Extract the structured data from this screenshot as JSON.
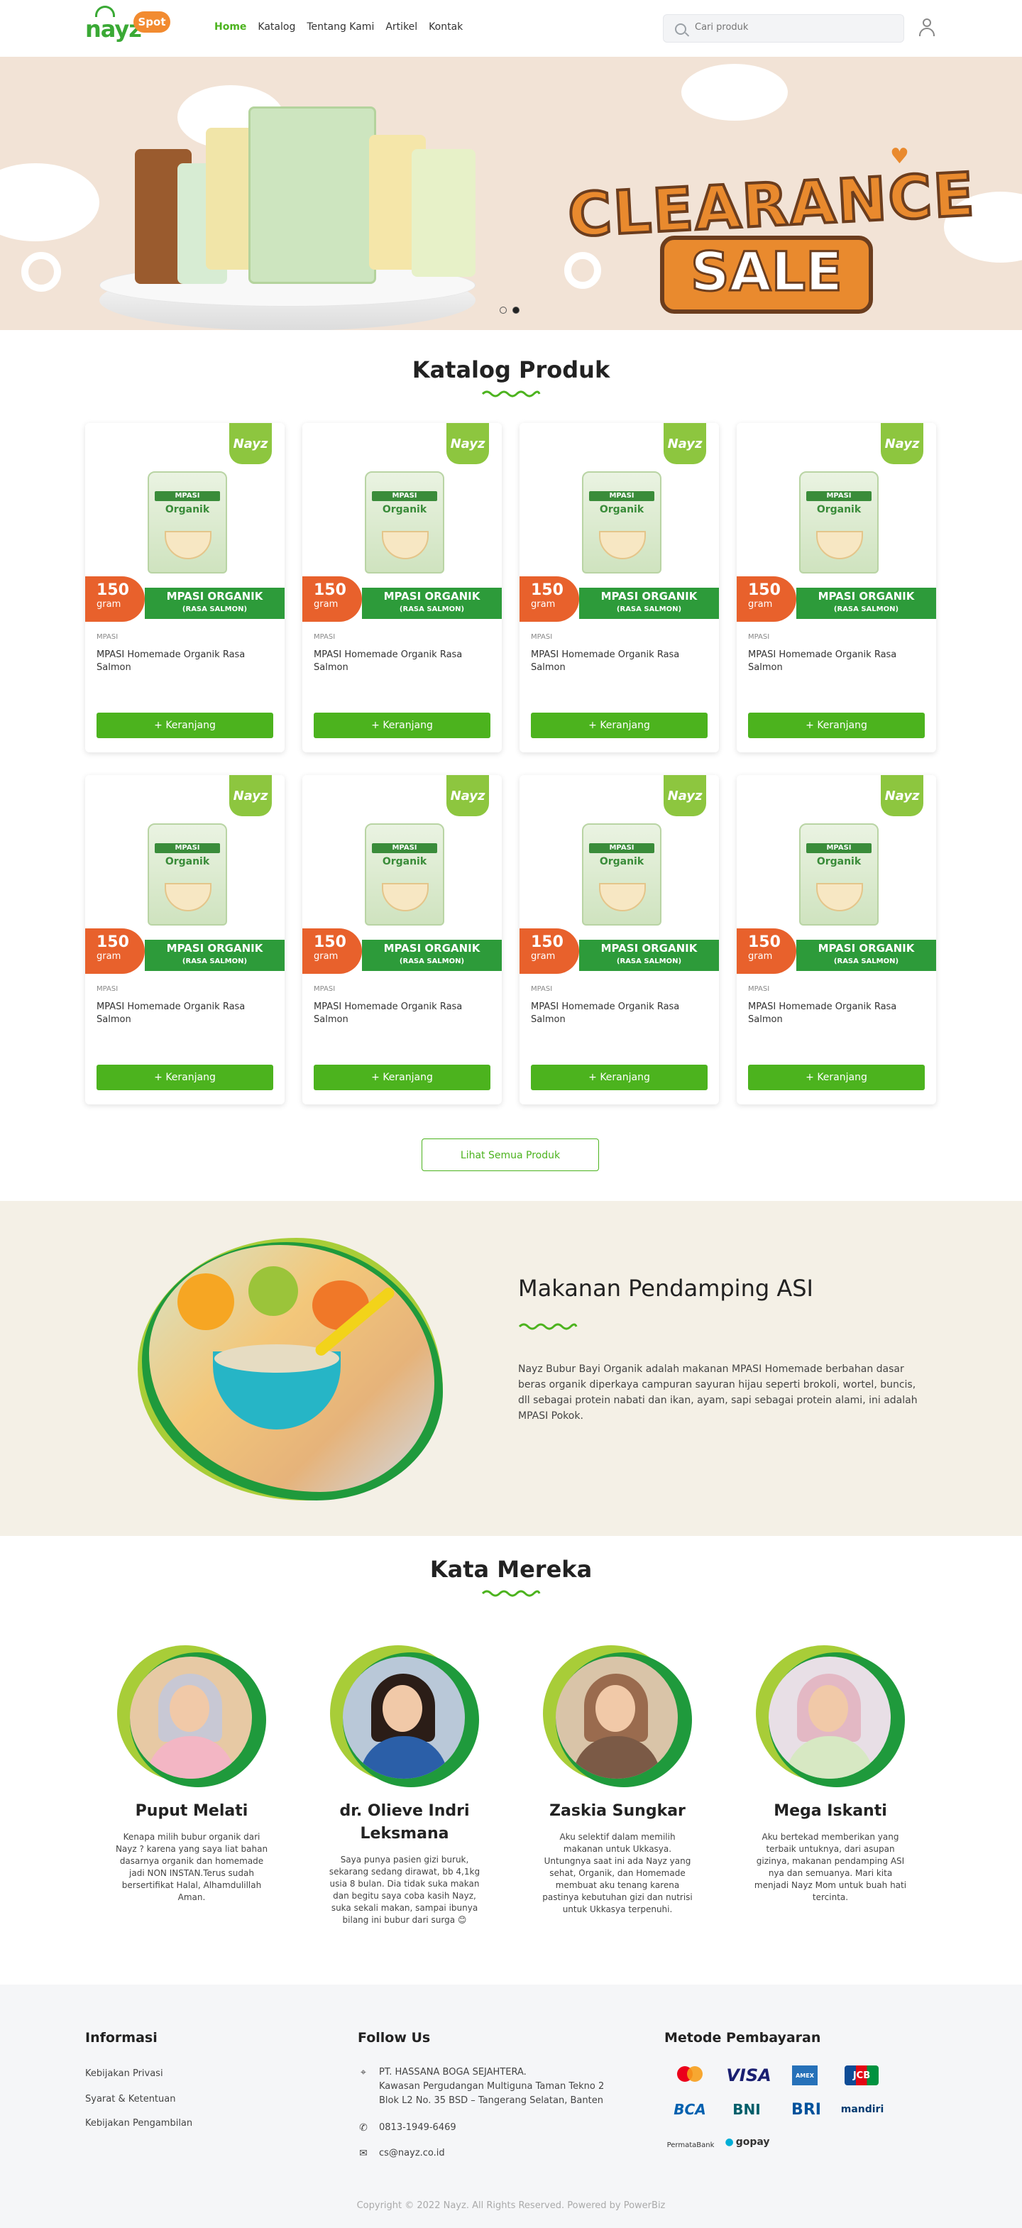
{
  "header": {
    "logo_main": "nayz",
    "logo_badge": "Spot",
    "nav": [
      {
        "label": "Home",
        "active": true
      },
      {
        "label": "Katalog",
        "active": false
      },
      {
        "label": "Tentang Kami",
        "active": false
      },
      {
        "label": "Artikel",
        "active": false
      },
      {
        "label": "Kontak",
        "active": false
      }
    ],
    "search_placeholder": "Cari produk"
  },
  "hero": {
    "headline": "CLEARANCE",
    "subline": "SALE",
    "slides": 2,
    "active_slide": 2
  },
  "catalog": {
    "title": "Katalog Produk",
    "products": [
      {
        "category": "MPASI",
        "name": "MPASI Homemade Organik Rasa Salmon",
        "weight": "150",
        "unit": "gram",
        "banner": "MPASI ORGANIK",
        "banner_sub": "(RASA SALMON)",
        "cart_label": "Keranjang",
        "brand": "Nayz"
      },
      {
        "category": "MPASI",
        "name": "MPASI Homemade Organik Rasa Salmon",
        "weight": "150",
        "unit": "gram",
        "banner": "MPASI ORGANIK",
        "banner_sub": "(RASA SALMON)",
        "cart_label": "Keranjang",
        "brand": "Nayz"
      },
      {
        "category": "MPASI",
        "name": "MPASI Homemade Organik Rasa Salmon",
        "weight": "150",
        "unit": "gram",
        "banner": "MPASI ORGANIK",
        "banner_sub": "(RASA SALMON)",
        "cart_label": "Keranjang",
        "brand": "Nayz"
      },
      {
        "category": "MPASI",
        "name": "MPASI Homemade Organik Rasa Salmon",
        "weight": "150",
        "unit": "gram",
        "banner": "MPASI ORGANIK",
        "banner_sub": "(RASA SALMON)",
        "cart_label": "Keranjang",
        "brand": "Nayz"
      },
      {
        "category": "MPASI",
        "name": "MPASI Homemade Organik Rasa Salmon",
        "weight": "150",
        "unit": "gram",
        "banner": "MPASI ORGANIK",
        "banner_sub": "(RASA SALMON)",
        "cart_label": "Keranjang",
        "brand": "Nayz"
      },
      {
        "category": "MPASI",
        "name": "MPASI Homemade Organik Rasa Salmon",
        "weight": "150",
        "unit": "gram",
        "banner": "MPASI ORGANIK",
        "banner_sub": "(RASA SALMON)",
        "cart_label": "Keranjang",
        "brand": "Nayz"
      },
      {
        "category": "MPASI",
        "name": "MPASI Homemade Organik Rasa Salmon",
        "weight": "150",
        "unit": "gram",
        "banner": "MPASI ORGANIK",
        "banner_sub": "(RASA SALMON)",
        "cart_label": "Keranjang",
        "brand": "Nayz"
      },
      {
        "category": "MPASI",
        "name": "MPASI Homemade Organik Rasa Salmon",
        "weight": "150",
        "unit": "gram",
        "banner": "MPASI ORGANIK",
        "banner_sub": "(RASA SALMON)",
        "cart_label": "Keranjang",
        "brand": "Nayz"
      }
    ],
    "pouch_label": "MPASI",
    "pouch_word": "Organik",
    "see_all": "Lihat Semua Produk"
  },
  "about": {
    "title": "Makanan Pendamping ASI",
    "text": "Nayz Bubur Bayi Organik adalah makanan MPASI Homemade berbahan dasar beras organik diperkaya campuran sayuran hijau seperti brokoli, wortel, buncis, dll sebagai protein nabati dan ikan, ayam, sapi sebagai protein alami, ini adalah MPASI Pokok."
  },
  "testimonials": {
    "title": "Kata Mereka",
    "items": [
      {
        "name": "Puput Melati",
        "quote": "Kenapa milih bubur organik dari Nayz ? karena yang saya liat bahan dasarnya organik dan homemade jadi NON INSTAN.Terus sudah bersertifikat Halal, Alhamdulillah Aman."
      },
      {
        "name": "dr. Olieve Indri Leksmana",
        "quote": "Saya punya pasien gizi buruk, sekarang sedang dirawat, bb 4,1kg usia 8 bulan. Dia tidak suka makan dan begitu saya coba kasih Nayz, suka sekali makan, sampai ibunya bilang ini bubur dari surga 😊"
      },
      {
        "name": "Zaskia Sungkar",
        "quote": "Aku selektif dalam memilih makanan untuk Ukkasya. Untungnya saat ini ada Nayz yang sehat, Organik, dan Homemade membuat aku tenang karena pastinya kebutuhan gizi dan nutrisi untuk Ukkasya terpenuhi."
      },
      {
        "name": "Mega Iskanti",
        "quote": "Aku bertekad memberikan yang terbaik untuknya, dari asupan gizinya, makanan pendamping ASI nya dan semuanya. Mari kita menjadi Nayz Mom untuk buah hati tercinta."
      }
    ]
  },
  "footer": {
    "info_title": "Informasi",
    "info_links": [
      "Kebijakan Privasi",
      "Syarat & Ketentuan",
      "Kebijakan Pengambilan"
    ],
    "follow_title": "Follow Us",
    "address": "PT. HASSANA BOGA SEJAHTERA.",
    "address2": "Kawasan Pergudangan Multiguna Taman Tekno 2",
    "address3": "Blok L2 No. 35 BSD – Tangerang Selatan, Banten",
    "phone": "0813-1949-6469",
    "email": "cs@nayz.co.id",
    "payment_title": "Metode Pembayaran",
    "payment_methods": [
      "mastercard",
      "VISA",
      "AMEX",
      "JCB",
      "BCA",
      "BNI",
      "BRI",
      "mandiri",
      "PermataBank",
      "gopay"
    ],
    "copyright": "Copyright © 2022 Nayz. All Rights Reserved. Powered by PowerBiz"
  }
}
